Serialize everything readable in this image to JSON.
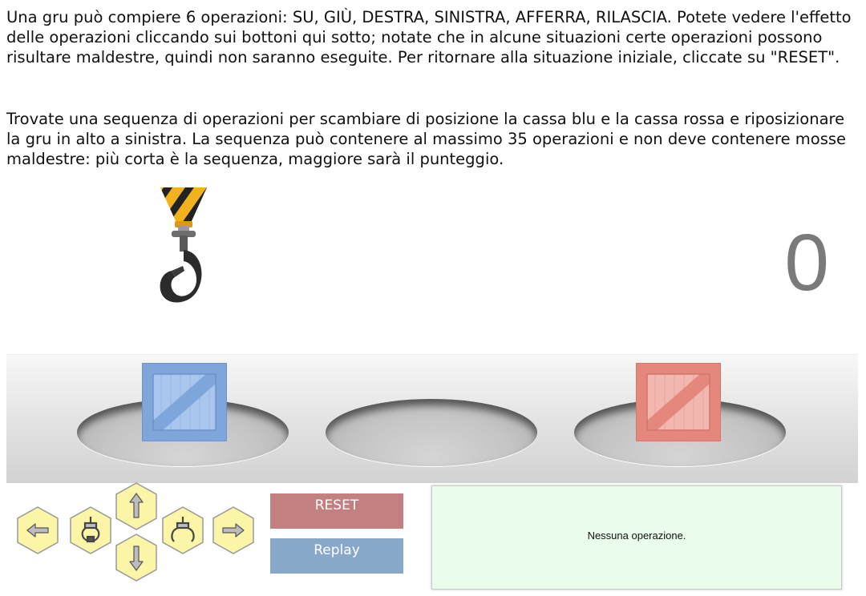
{
  "instructions": {
    "paragraph_1": "Una gru può compiere 6 operazioni: SU, GIÙ, DESTRA, SINISTRA, AFFERRA, RILASCIA. Potete vedere l'effetto delle operazioni cliccando sui bottoni qui sotto; notate che in alcune situazioni certe operazioni possono risultare maldestre, quindi non saranno eseguite. Per ritornare alla situazione iniziale, cliccate su \"RESET\".",
    "paragraph_2": "Trovate una sequenza di operazioni per scambiare di posizione la cassa blu e la cassa rossa e riposizionare la gru in alto a sinistra. La sequenza può contenere al massimo 35 operazioni e non deve contenere mosse maldestre: più corta è la sequenza, maggiore sarà il punteggio."
  },
  "game": {
    "operation_count": "0",
    "crates": [
      {
        "name": "blue-crate",
        "color": "#86aee0",
        "slot": 1
      },
      {
        "name": "red-crate",
        "color": "#e89a92",
        "slot": 3
      }
    ],
    "crane_position": {
      "column": 1,
      "level": "top"
    }
  },
  "controls": {
    "arrow_buttons": [
      {
        "name": "left-arrow-icon"
      },
      {
        "name": "grab-claw-icon"
      },
      {
        "name": "up-arrow-icon"
      },
      {
        "name": "down-arrow-icon"
      },
      {
        "name": "release-claw-icon"
      },
      {
        "name": "right-arrow-icon"
      }
    ],
    "button_color": "#fbf5a8",
    "reset_label": "RESET",
    "replay_label": "Replay"
  },
  "log": {
    "message": "Nessuna operazione."
  }
}
